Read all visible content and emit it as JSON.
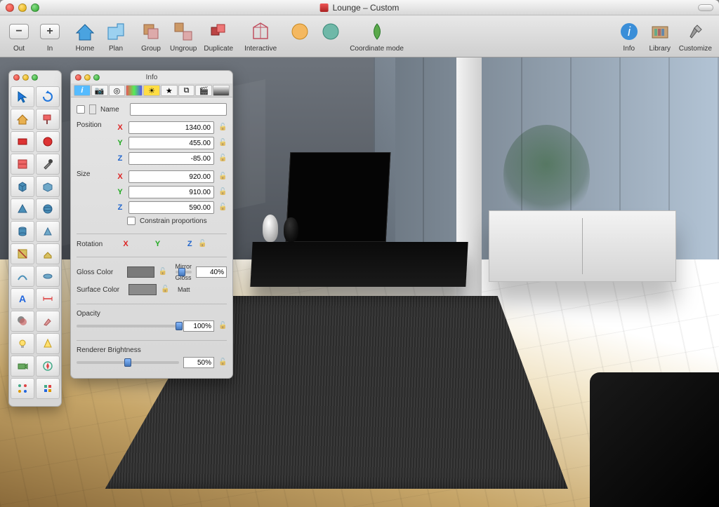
{
  "window": {
    "title": "Lounge – Custom"
  },
  "toolbar": {
    "zoom_out": "Out",
    "zoom_in": "In",
    "home": "Home",
    "plan": "Plan",
    "group": "Group",
    "ungroup": "Ungroup",
    "duplicate": "Duplicate",
    "interactive": "Interactive",
    "coordinate": "Coordinate mode",
    "info": "Info",
    "library": "Library",
    "customize": "Customize"
  },
  "info_panel": {
    "title": "Info",
    "name_label": "Name",
    "name_value": "",
    "position_label": "Position",
    "position": {
      "x": "1340.00",
      "y": "455.00",
      "z": "-85.00"
    },
    "size_label": "Size",
    "size": {
      "x": "920.00",
      "y": "910.00",
      "z": "590.00"
    },
    "constrain_label": "Constrain proportions",
    "rotation_label": "Rotation",
    "rotation_axes": {
      "x": "X",
      "y": "Y",
      "z": "Z"
    },
    "gloss_label": "Gloss Color",
    "surface_label": "Surface Color",
    "mirror_label": "Mirror",
    "gloss_sub": "Gloss",
    "matt_label": "Matt",
    "gloss_pct": "40%",
    "opacity_label": "Opacity",
    "opacity_pct": "100%",
    "brightness_label": "Renderer Brightness",
    "brightness_pct": "50%"
  },
  "sliders": {
    "gloss": 40,
    "opacity": 100,
    "brightness": 50
  },
  "tool_palette": {
    "tools": [
      "select-arrow",
      "rotate-tool",
      "house-tool",
      "paint-tool",
      "rectangle-tool",
      "circle-tool",
      "wall-tool",
      "eyedropper-tool",
      "cube-tool",
      "box-tool",
      "cone-tool",
      "sphere-tool",
      "cylinder-tool",
      "prism-tool",
      "cut-tool",
      "extrude-tool",
      "path-tool",
      "lathe-tool",
      "text-tool",
      "dimension-tool",
      "shadow-tool",
      "brush-tool",
      "bulb-tool",
      "light-tool",
      "camera-tool",
      "compass-tool",
      "node-tool",
      "snap-tool"
    ]
  },
  "info_tabs": [
    "info",
    "camera",
    "target",
    "palette",
    "sun",
    "star",
    "copy",
    "film",
    "gradient"
  ]
}
